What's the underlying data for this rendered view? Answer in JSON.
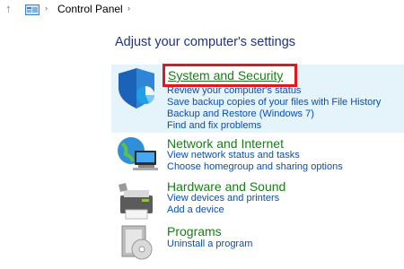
{
  "address_bar": {
    "breadcrumb": "Control Panel"
  },
  "heading": "Adjust your computer's settings",
  "categories": [
    {
      "title": "System and Security",
      "links": [
        "Review your computer's status",
        "Save backup copies of your files with File History",
        "Backup and Restore (Windows 7)",
        "Find and fix problems"
      ]
    },
    {
      "title": "Network and Internet",
      "links": [
        "View network status and tasks",
        "Choose homegroup and sharing options"
      ]
    },
    {
      "title": "Hardware and Sound",
      "links": [
        "View devices and printers",
        "Add a device"
      ]
    },
    {
      "title": "Programs",
      "links": [
        "Uninstall a program"
      ]
    }
  ],
  "colors": {
    "heading": "#1e3287",
    "category_title": "#1a7d1a",
    "link": "#0b4fae",
    "highlight_bg": "#e5f3fb",
    "focus_box": "#e3161b"
  }
}
